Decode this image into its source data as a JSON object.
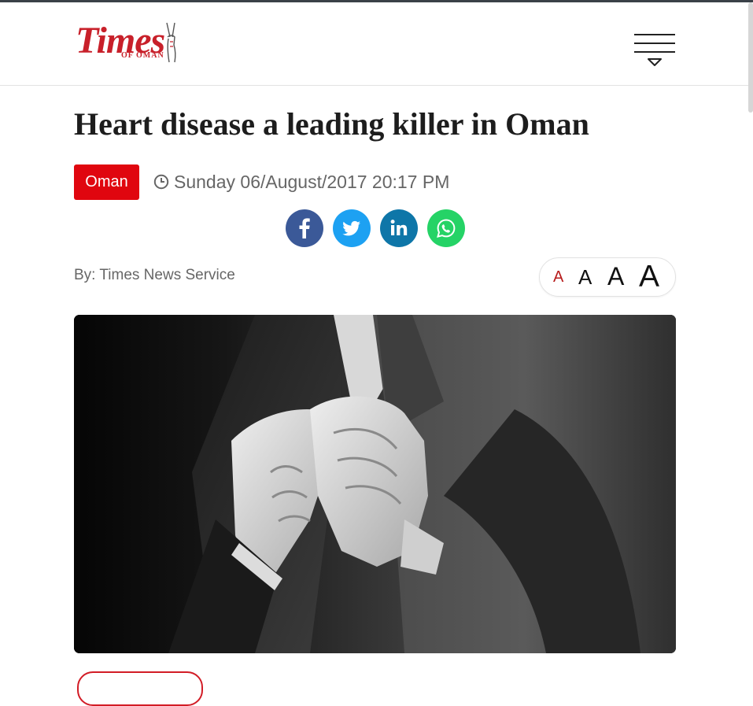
{
  "header": {
    "logo": {
      "main": "Times",
      "sub": "OF OMAN"
    },
    "menu_icon": "hamburger-menu-icon"
  },
  "article": {
    "title": "Heart disease a leading killer in Oman",
    "category": "Oman",
    "date": "Sunday 06/August/2017 20:17 PM",
    "byline": "By: Times News Service"
  },
  "share": [
    {
      "name": "facebook",
      "icon": "facebook-icon",
      "color": "#3b5998"
    },
    {
      "name": "twitter",
      "icon": "twitter-icon",
      "color": "#1da1f2"
    },
    {
      "name": "linkedin",
      "icon": "linkedin-icon",
      "color": "#0e76a8"
    },
    {
      "name": "whatsapp",
      "icon": "whatsapp-icon",
      "color": "#25d366"
    }
  ],
  "font_sizes": {
    "labels": [
      "A",
      "A",
      "A",
      "A"
    ],
    "active_color": "#b71c1c"
  },
  "colors": {
    "accent": "#e0060f",
    "logo": "#c8202a"
  }
}
